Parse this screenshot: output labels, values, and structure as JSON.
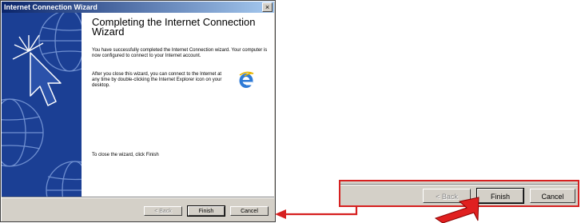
{
  "window": {
    "title": "Internet Connection Wizard",
    "close_label": "×"
  },
  "content": {
    "heading": "Completing the Internet Connection Wizard",
    "paragraph1": "You have successfully completed the Internet Connection wizard. Your computer is now configured to connect to your Internet account.",
    "paragraph2": "After you close this wizard, you can connect to the Internet at any time by double-clicking the Internet Explorer icon on your desktop.",
    "paragraph3": "To close the wizard, click Finish"
  },
  "buttons": {
    "back": "< Back",
    "finish": "Finish",
    "cancel": "Cancel"
  },
  "icons": {
    "side_panel": "globe-cursor-graphic",
    "browser": "internet-explorer-icon"
  },
  "colors": {
    "title_bar": "#0a246a",
    "side_panel": "#1b3f94",
    "highlight": "#d62020",
    "window_face": "#d4d0c8"
  }
}
